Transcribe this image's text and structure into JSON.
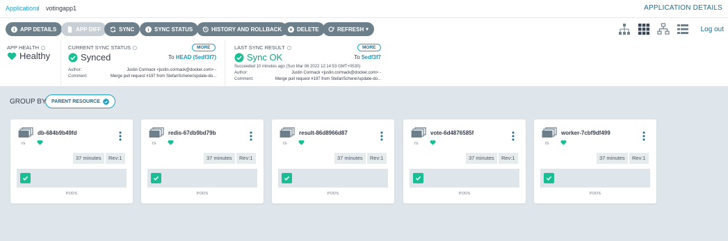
{
  "header": {
    "breadcrumb_root": "Applications",
    "breadcrumb_sep": "/",
    "breadcrumb_current": "votingapp1",
    "page_title": "APPLICATION DETAILS",
    "logout": "Log out"
  },
  "toolbar": {
    "buttons": [
      {
        "label": "APP DETAILS",
        "icon": "info-circle-icon"
      },
      {
        "label": "APP DIFF",
        "icon": "file-icon"
      },
      {
        "label": "SYNC",
        "icon": "sync-icon"
      },
      {
        "label": "SYNC STATUS",
        "icon": "info-circle-icon"
      },
      {
        "label": "HISTORY AND ROLLBACK",
        "icon": "history-icon"
      },
      {
        "label": "DELETE",
        "icon": "times-circle-icon"
      },
      {
        "label": "REFRESH",
        "icon": "redo-icon"
      }
    ],
    "view_icons": [
      "tree-view-icon",
      "pods-view-icon",
      "network-view-icon",
      "list-view-icon"
    ]
  },
  "status": {
    "app_health": {
      "label": "APP HEALTH",
      "value": "Healthy"
    },
    "current_sync": {
      "label": "CURRENT SYNC STATUS",
      "value": "Synced",
      "more": "MORE",
      "to_prefix": "To",
      "to_ref": "HEAD (5edf3f7)",
      "author_label": "Author:",
      "author": "Justin Cormack <justin.cormack@docker.com> -",
      "comment_label": "Comment:",
      "comment": "Merge pull request #197 from StefanScherer/update-do..."
    },
    "last_sync": {
      "label": "LAST SYNC RESULT",
      "value": "Sync OK",
      "more": "MORE",
      "to_prefix": "To",
      "to_ref": "5edf3f7",
      "succeeded": "Succeeded 10 minutes ago (Sun Mar 06 2022 12:14:53 GMT+0530)",
      "author_label": "Author:",
      "author": "Justin Cormack <justin.cormack@docker.com> -",
      "comment_label": "Comment:",
      "comment": "Merge pull request #197 from StefanScherer/update-do..."
    }
  },
  "group_by": {
    "label": "GROUP BY:",
    "value": "PARENT RESOURCE"
  },
  "cards": [
    {
      "name": "db-684b9b49fd",
      "kind": "rs",
      "age": "37 minutes",
      "rev": "Rev:1",
      "pods_label": "PODS"
    },
    {
      "name": "redis-67db9bd79b",
      "kind": "rs",
      "age": "37 minutes",
      "rev": "Rev:1",
      "pods_label": "PODS"
    },
    {
      "name": "result-86d8966d87",
      "kind": "rs",
      "age": "37 minutes",
      "rev": "Rev:1",
      "pods_label": "PODS"
    },
    {
      "name": "vote-6d4876585f",
      "kind": "rs",
      "age": "37 minutes",
      "rev": "Rev:1",
      "pods_label": "PODS"
    },
    {
      "name": "worker-7cbf9df499",
      "kind": "rs",
      "age": "37 minutes",
      "rev": "Rev:1",
      "pods_label": "PODS"
    }
  ],
  "colors": {
    "healthy": "#18be94",
    "accent": "#20a0c0",
    "button": "#6d7f8b"
  }
}
